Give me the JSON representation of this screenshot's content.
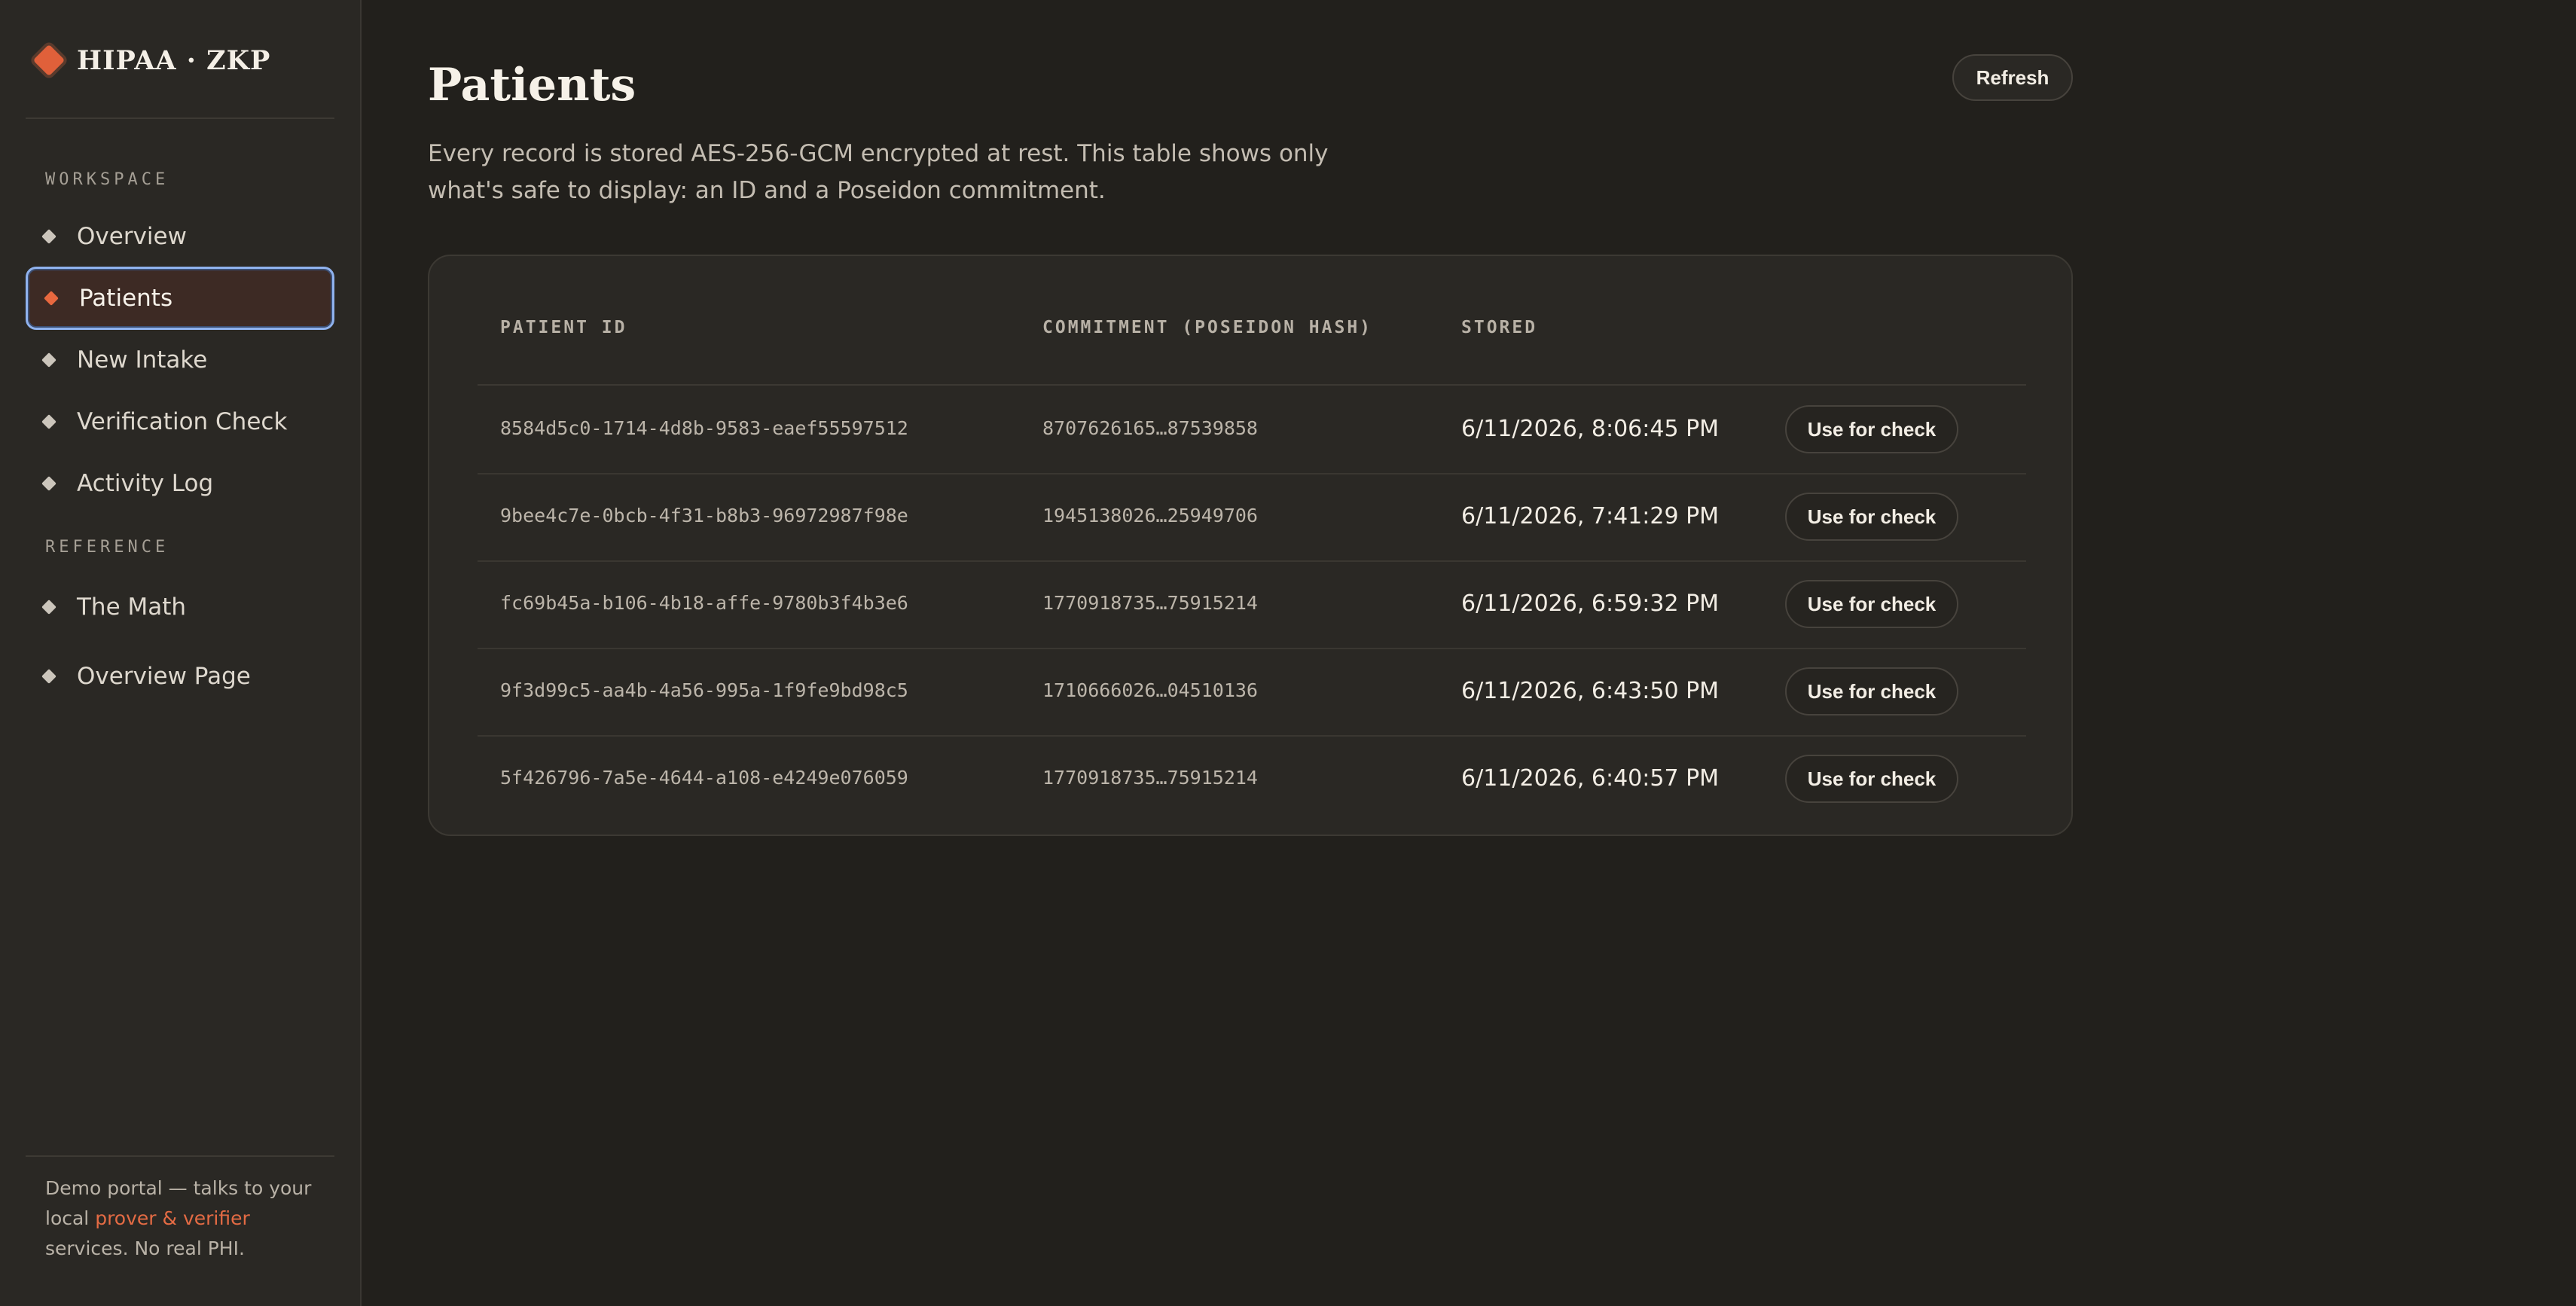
{
  "brand": {
    "name": "HIPAA · ZKP"
  },
  "sidebar": {
    "sections": [
      {
        "label": "WORKSPACE"
      },
      {
        "label": "REFERENCE"
      }
    ],
    "items": [
      {
        "label": "Overview",
        "active": false
      },
      {
        "label": "Patients",
        "active": true
      },
      {
        "label": "New Intake",
        "active": false
      },
      {
        "label": "Verification Check",
        "active": false
      },
      {
        "label": "Activity Log",
        "active": false
      },
      {
        "label": "The Math",
        "active": false
      },
      {
        "label": "Overview Page",
        "active": false
      }
    ],
    "footer": {
      "text_before": "Demo portal — talks to your local ",
      "link": "prover & verifier",
      "text_after": " services. No real PHI."
    }
  },
  "main": {
    "title": "Patients",
    "subtitle": "Every record is stored AES-256-GCM encrypted at rest. This table shows only what's safe to display: an ID and a Poseidon commitment.",
    "refresh_label": "Refresh",
    "table": {
      "columns": [
        "PATIENT ID",
        "COMMITMENT (POSEIDON HASH)",
        "STORED"
      ],
      "action_label": "Use for check",
      "rows": [
        {
          "id": "8584d5c0-1714-4d8b-9583-eaef55597512",
          "commitment": "8707626165…87539858",
          "stored": "6/11/2026, 8:06:45 PM"
        },
        {
          "id": "9bee4c7e-0bcb-4f31-b8b3-96972987f98e",
          "commitment": "1945138026…25949706",
          "stored": "6/11/2026, 7:41:29 PM"
        },
        {
          "id": "fc69b45a-b106-4b18-affe-9780b3f4b3e6",
          "commitment": "1770918735…75915214",
          "stored": "6/11/2026, 6:59:32 PM"
        },
        {
          "id": "9f3d99c5-aa4b-4a56-995a-1f9fe9bd98c5",
          "commitment": "1710666026…04510136",
          "stored": "6/11/2026, 6:43:50 PM"
        },
        {
          "id": "5f426796-7a5e-4644-a108-e4249e076059",
          "commitment": "1770918735…75915214",
          "stored": "6/11/2026, 6:40:57 PM"
        }
      ]
    }
  },
  "colors": {
    "accent": "#e0603a",
    "focus_ring": "#8fb2ee",
    "background": "#22201c",
    "surface": "#2a2824"
  }
}
